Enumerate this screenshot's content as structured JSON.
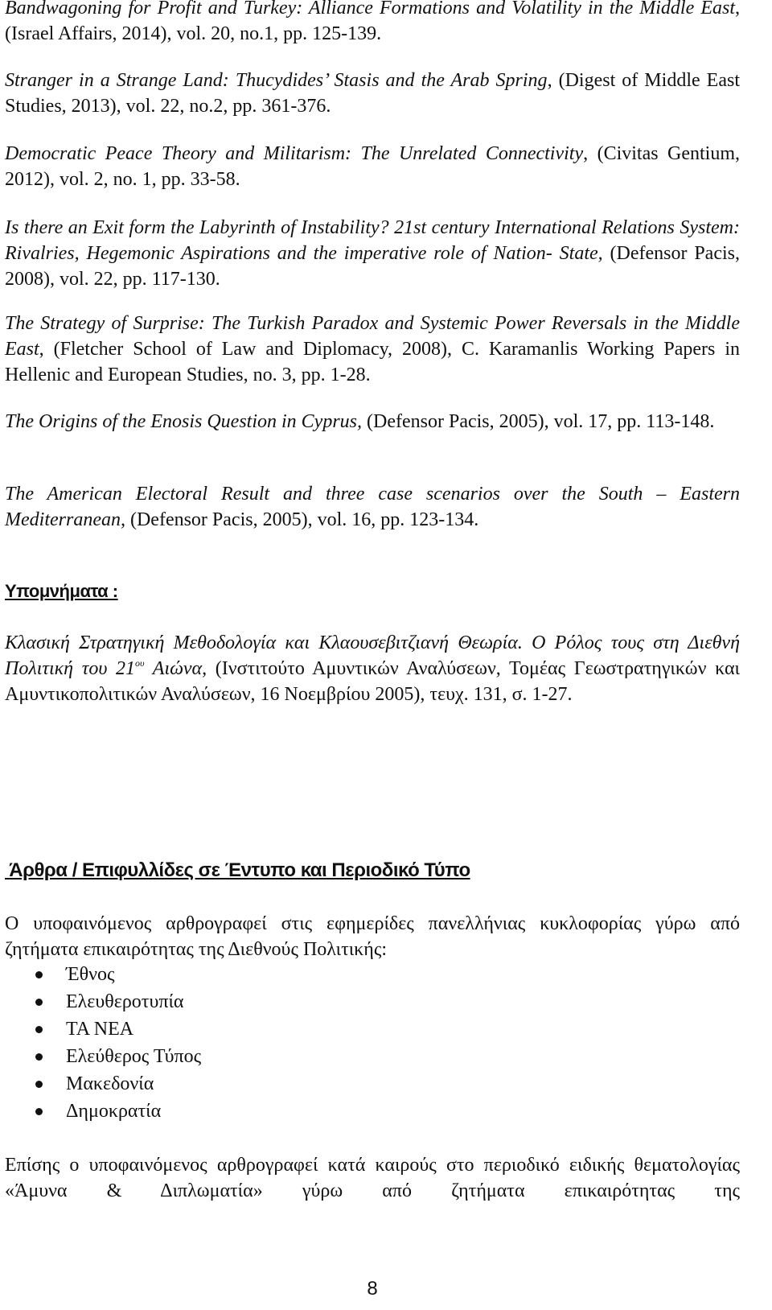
{
  "references": [
    {
      "title": "Bandwagoning for Profit and Turkey: Alliance Formations and Volatility in the Middle East",
      "details": ", (Israel Affairs, 2014), vol. 20, no.1, pp. 125-139."
    },
    {
      "title": "Stranger in a Strange Land: Thucydides’ Stasis and the Arab Spring",
      "details": ", (Digest of Middle East Studies, 2013), vol. 22, no.2, pp. 361-376."
    },
    {
      "title": "Democratic Peace Theory and Militarism: The Unrelated Connectivity",
      "details": ", (Civitas Gentium, 2012), vol. 2, no. 1, pp. 33-58."
    },
    {
      "title": "Is there an Exit form the Labyrinth of Instability? 21st century International Relations System: Rivalries, Hegemonic Aspirations and the imperative role of Nation- State,",
      "details": " (Defensor Pacis, 2008), vol. 22, pp. 117-130."
    },
    {
      "title": "The Strategy of Surprise: The Turkish Paradox and Systemic Power Reversals in the Middle East",
      "details": ", (Fletcher School of Law and Diplomacy, 2008), C. Karamanlis Working Papers in Hellenic and European Studies, no. 3, pp. 1-28."
    },
    {
      "title": "The Origins of the Enosis Question in Cyprus,",
      "details": " (Defensor Pacis, 2005), vol. 17, pp. 113-148."
    },
    {
      "title": "The American Electoral Result and three case scenarios over the South – Eastern Mediterranean,",
      "details": " (Defensor Pacis, 2005), vol. 16, pp. 123-134."
    }
  ],
  "memoranda": {
    "heading": "Υπομνήματα :",
    "entry": {
      "title_part1": "Κλασική Στρατηγική Μεθοδολογία και Κλαουσεβιτζιανή Θεωρία.  Ο Ρόλος τους στη Διεθνή Πολιτική του 21",
      "superscript": "ου",
      "title_part2": " Αιώνα,",
      "details": " (Ινστιτούτο Αμυντικών Αναλύσεων, Τομέας Γεωστρατηγικών και Αμυντικοπολιτικών Αναλύσεων, 16 Νοεμβρίου 2005), τευχ. 131, σ. 1-27."
    }
  },
  "articles": {
    "heading": " Άρθρα / Επιφυλλίδες σε Έντυπο και Περιοδικό Τύπο",
    "intro": "Ο υποφαινόμενος αρθρογραφεί στις εφημερίδες πανελλήνιας κυκλοφορίας γύρω από ζητήματα επικαιρότητας της Διεθνούς Πολιτικής:",
    "newspapers": [
      "Έθνος",
      "Ελευθεροτυπία",
      "ΤΑ ΝΕΑ",
      "Ελεύθερος Τύπος",
      "Μακεδονία",
      "Δημοκρατία"
    ],
    "closing": "Επίσης ο υποφαινόμενος αρθρογραφεί κατά καιρούς στο περιοδικό ειδικής θεματολογίας «Άμυνα & Διπλωματία» γύρω από ζητήματα επικαιρότητας της"
  },
  "page_number": "8"
}
